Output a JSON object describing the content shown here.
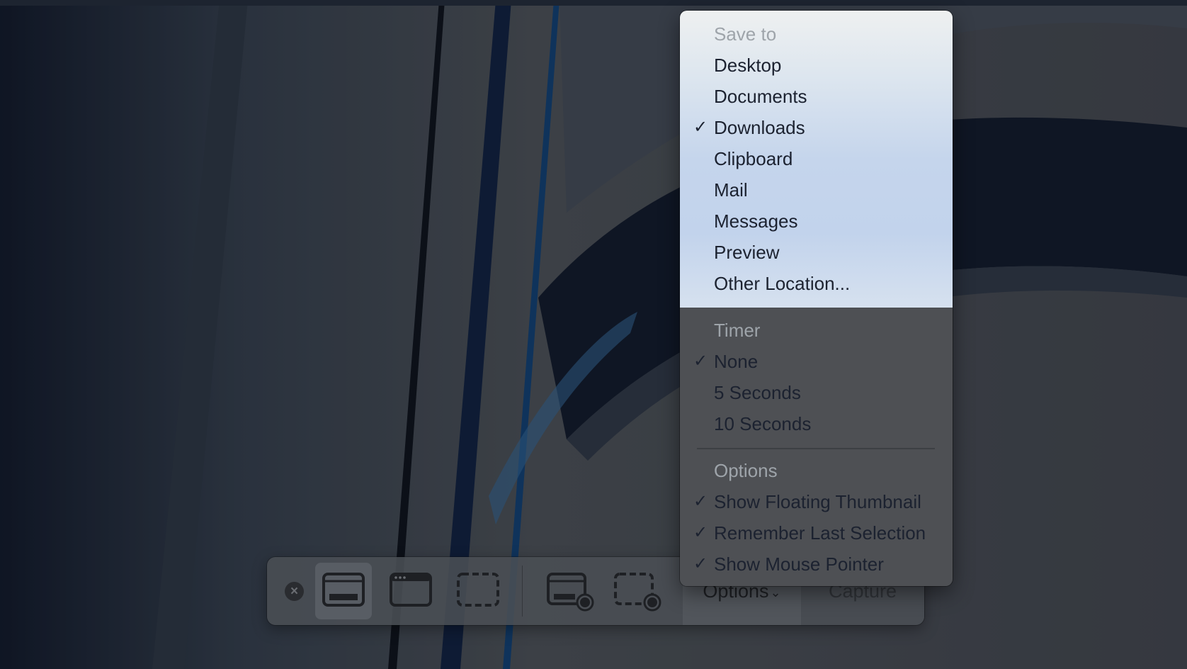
{
  "menu": {
    "save_to": {
      "header": "Save to",
      "items": [
        {
          "label": "Desktop",
          "checked": false
        },
        {
          "label": "Documents",
          "checked": false
        },
        {
          "label": "Downloads",
          "checked": true
        },
        {
          "label": "Clipboard",
          "checked": false
        },
        {
          "label": "Mail",
          "checked": false
        },
        {
          "label": "Messages",
          "checked": false
        },
        {
          "label": "Preview",
          "checked": false
        },
        {
          "label": "Other Location...",
          "checked": false
        }
      ]
    },
    "timer": {
      "header": "Timer",
      "items": [
        {
          "label": "None",
          "checked": true
        },
        {
          "label": "5 Seconds",
          "checked": false
        },
        {
          "label": "10 Seconds",
          "checked": false
        }
      ]
    },
    "options": {
      "header": "Options",
      "items": [
        {
          "label": "Show Floating Thumbnail",
          "checked": true
        },
        {
          "label": "Remember Last Selection",
          "checked": true
        },
        {
          "label": "Show Mouse Pointer",
          "checked": true
        }
      ]
    },
    "check_glyph": "✓"
  },
  "toolbar": {
    "close_glyph": "×",
    "tools": [
      {
        "name": "capture-entire-screen",
        "selected": true
      },
      {
        "name": "capture-selected-window",
        "selected": false
      },
      {
        "name": "capture-selected-portion",
        "selected": false
      },
      {
        "name": "record-entire-screen",
        "selected": false
      },
      {
        "name": "record-selected-portion",
        "selected": false
      }
    ],
    "options_label": "Options",
    "chevron_glyph": "⌄",
    "capture_label": "Capture"
  }
}
